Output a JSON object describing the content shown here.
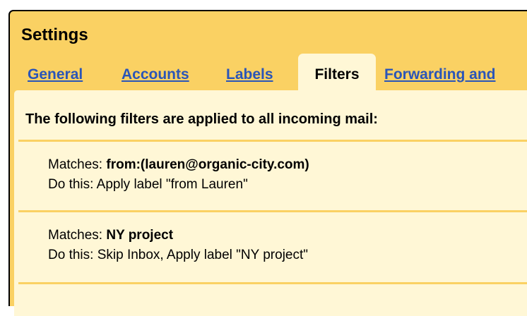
{
  "settings": {
    "title": "Settings",
    "tabs": [
      {
        "label": "General",
        "active": false
      },
      {
        "label": "Accounts",
        "active": false
      },
      {
        "label": "Labels",
        "active": false
      },
      {
        "label": "Filters",
        "active": true
      },
      {
        "label": "Forwarding and",
        "active": false
      }
    ]
  },
  "filters": {
    "heading": "The following filters are applied to all incoming mail:",
    "items": [
      {
        "matches_label": "Matches: ",
        "matches_value": "from:(lauren@organic-city.com)",
        "action_label": "Do this: ",
        "action_value": "Apply label \"from Lauren\""
      },
      {
        "matches_label": "Matches: ",
        "matches_value": "NY project",
        "action_label": "Do this: ",
        "action_value": "Skip Inbox, Apply label \"NY project\""
      }
    ]
  },
  "colors": {
    "frame_background": "#fad163",
    "panel_background": "#fff7d6",
    "link": "#2a55b8"
  }
}
